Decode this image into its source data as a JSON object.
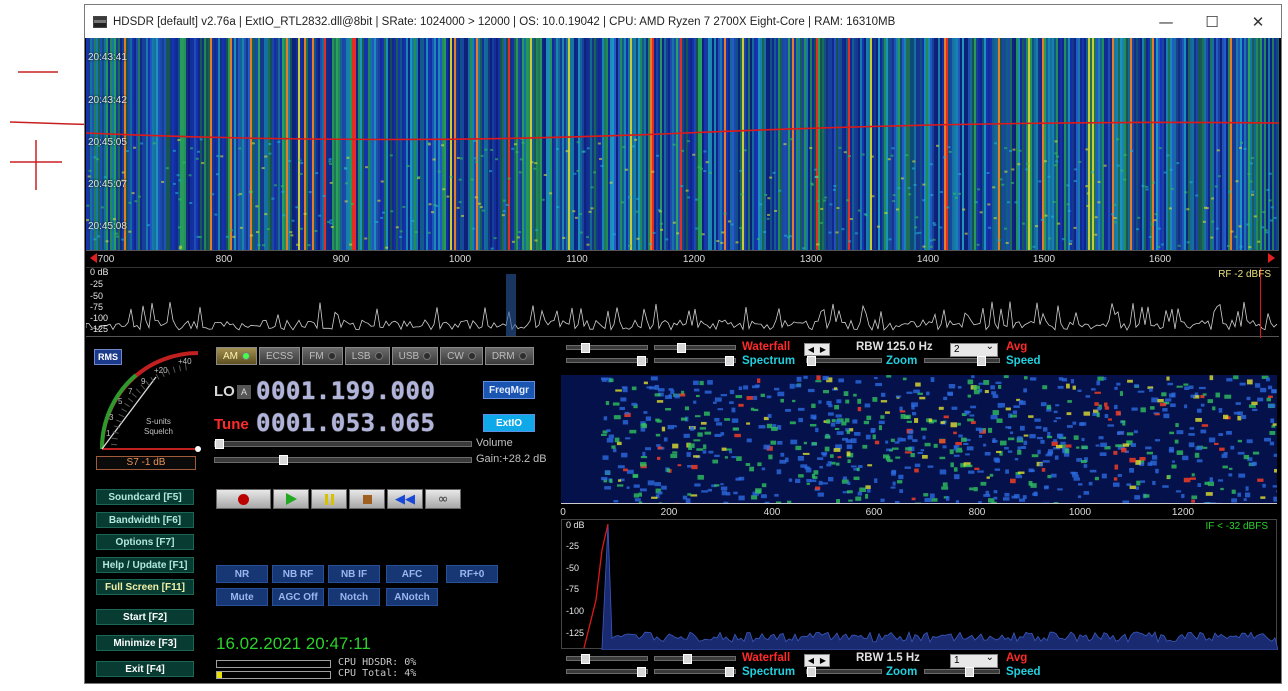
{
  "window": {
    "title": "HDSDR  [default]  v2.76a  |  ExtIO_RTL2832.dll@8bit  |  SRate: 1024000 > 12000  |  OS: 10.0.19042  |  CPU: AMD Ryzen 7 2700X Eight-Core         |  RAM: 16310MB",
    "min": "—",
    "max": "☐",
    "close": "✕"
  },
  "main_waterfall": {
    "timestamps": [
      "20:43:41",
      "20:43:42",
      "20:45:05",
      "20:45:07",
      "20:45:08"
    ],
    "freq_ticks": [
      "700",
      "800",
      "900",
      "1000",
      "1100",
      "1200",
      "1300",
      "1400",
      "1500",
      "1600"
    ]
  },
  "rf_spectrum": {
    "db_labels": [
      "0 dB",
      "-25",
      "-50",
      "-75",
      "-100",
      "-125"
    ],
    "rf_level": "RF  -2 dBFS"
  },
  "smeter": {
    "rms_label": "RMS",
    "scale": [
      "1",
      "3",
      "5",
      "7",
      "9",
      "+20",
      "+40"
    ],
    "caption1": "S-units",
    "caption2": "Squelch",
    "reading": "S7 -1 dB"
  },
  "left_buttons": [
    "Soundcard  [F5]",
    "Bandwidth  [F6]",
    "Options    [F7]",
    "Help / Update  [F1]",
    "Full Screen  [F11]",
    "Start     [F2]",
    "Minimize  [F3]",
    "Exit     [F4]"
  ],
  "modes": [
    "AM",
    "ECSS",
    "FM",
    "LSB",
    "USB",
    "CW",
    "DRM"
  ],
  "tuning": {
    "lo_label": "LO",
    "lo_lock": "A",
    "lo_value": "0001.199.000",
    "tune_label": "Tune",
    "tune_value": "0001.053.065",
    "freqmgr": "FreqMgr",
    "extio": "ExtIO",
    "volume_label": "Volume",
    "gain_label": "Gain:+28.2 dB"
  },
  "dsp": {
    "row1": [
      "NR",
      "NB RF",
      "NB IF",
      "AFC",
      "RF+0"
    ],
    "row2": [
      "Mute",
      "AGC Off",
      "Notch",
      "ANotch"
    ]
  },
  "status": {
    "datetime": "16.02.2021 20:47:11",
    "cpu_hdsdr": "CPU HDSDR:  0%",
    "cpu_total": "CPU Total:  4%",
    "cpu_total_fraction": 0.04
  },
  "rf_controls": {
    "waterfall": "Waterfall",
    "spectrum": "Spectrum",
    "rbw": "RBW  125.0 Hz",
    "avg_value": "2",
    "avg": "Avg",
    "zoom": "Zoom",
    "speed": "Speed"
  },
  "af_controls": {
    "waterfall": "Waterfall",
    "spectrum": "Spectrum",
    "rbw": "RBW   1.5 Hz",
    "avg_value": "1",
    "avg": "Avg",
    "zoom": "Zoom",
    "speed": "Speed"
  },
  "af_waterfall": {
    "ticks": [
      "0",
      "200",
      "400",
      "600",
      "800",
      "1000",
      "1200"
    ]
  },
  "af_spectrum": {
    "db_labels": [
      "0 dB",
      "-25",
      "-50",
      "-75",
      "-100",
      "-125"
    ],
    "if_level": "IF < -32 dBFS"
  },
  "colors": {
    "wf_bg": "#05114a",
    "accent_red": "#ff2a2a",
    "accent_cyan": "#20d0e0",
    "green_text": "#2ad22a"
  }
}
